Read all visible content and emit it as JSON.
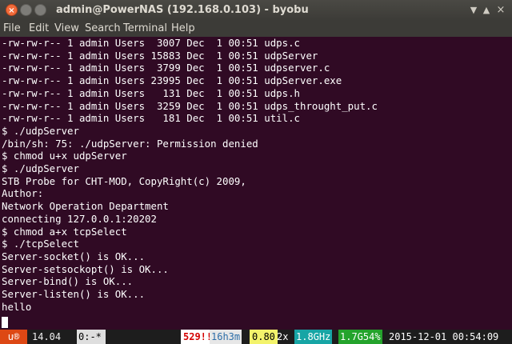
{
  "window": {
    "title": "admin@PowerNAS (192.168.0.103) - byobu",
    "close_glyph": "×",
    "min_glyph": "–",
    "max_glyph": "□"
  },
  "menubar": {
    "items": [
      "File",
      "Edit",
      "View",
      "Search",
      "Terminal",
      "Help"
    ]
  },
  "terminal": {
    "lines": [
      "-rw-rw-r-- 1 admin Users  3007 Dec  1 00:51 udps.c",
      "-rw-rw-r-- 1 admin Users 15883 Dec  1 00:51 udpServer",
      "-rw-rw-r-- 1 admin Users  3799 Dec  1 00:51 udpserver.c",
      "-rw-rw-r-- 1 admin Users 23995 Dec  1 00:51 udpServer.exe",
      "-rw-rw-r-- 1 admin Users   131 Dec  1 00:51 udps.h",
      "-rw-rw-r-- 1 admin Users  3259 Dec  1 00:51 udps_throught_put.c",
      "-rw-rw-r-- 1 admin Users   181 Dec  1 00:51 util.c",
      "$ ./udpServer",
      "/bin/sh: 75: ./udpServer: Permission denied",
      "$ chmod u+x udpServer",
      "$ ./udpServer",
      "STB Probe for CHT-MOD, CopyRight(c) 2009,",
      "Author:",
      "Network Operation Department",
      "connecting 127.0.0.1:20202",
      "$ chmod a+x tcpSelect",
      "$ ./tcpSelect",
      "Server-socket() is OK...",
      "Server-setsockopt() is OK...",
      "Server-bind() is OK...",
      "Server-listen() is OK...",
      "hello"
    ]
  },
  "statusbar": {
    "distro_badge": "u®",
    "version": "14.04",
    "session": "0:-*",
    "updates": "529!!",
    "uptime": "16h3m",
    "load": "0.80",
    "cpu_count": "2x",
    "cpu_freq": "1.8GHz",
    "memory": "1.7G54%",
    "datetime": "2015-12-01 00:54:09"
  }
}
